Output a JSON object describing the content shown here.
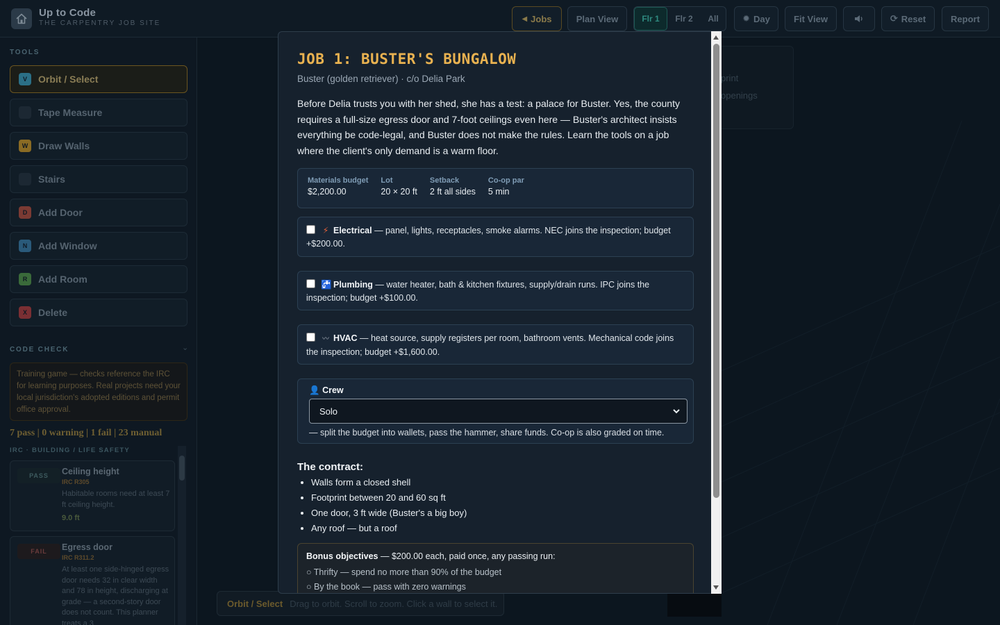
{
  "app": {
    "title": "Up to Code",
    "subtitle": "THE CARPENTRY JOB SITE"
  },
  "toolbar": {
    "jobs": "Jobs",
    "plan_view": "Plan View",
    "floors": [
      "Flr 1",
      "Flr 2",
      "All"
    ],
    "active_floor": "Flr 1",
    "day": "Day",
    "fit_view": "Fit View",
    "sound_icon": "speaker-icon",
    "reset": "Reset",
    "report": "Report"
  },
  "sidebar": {
    "tools_heading": "TOOLS",
    "tools": [
      {
        "key": "V",
        "label": "Orbit / Select",
        "color": "#2b6f86",
        "active": true
      },
      {
        "key": "",
        "label": "Tape Measure",
        "color": "#1c2833",
        "active": false
      },
      {
        "key": "W",
        "label": "Draw Walls",
        "color": "#8a6b24",
        "active": false
      },
      {
        "key": "",
        "label": "Stairs",
        "color": "#1c2833",
        "active": false
      },
      {
        "key": "D",
        "label": "Add Door",
        "color": "#7a3a33",
        "active": false
      },
      {
        "key": "N",
        "label": "Add Window",
        "color": "#2a5a7a",
        "active": false
      },
      {
        "key": "R",
        "label": "Add Room",
        "color": "#3a6a3a",
        "active": false
      },
      {
        "key": "X",
        "label": "Delete",
        "color": "#7a2f33",
        "active": false
      }
    ],
    "code_check_heading": "CODE CHECK",
    "code_check_toggle": "⌄",
    "notice": "Training game — checks reference the IRC for learning purposes. Real projects need your local jurisdiction's adopted editions and permit office approval.",
    "summary": "7 pass | 0 warning | 1 fail | 23 manual",
    "group_heading": "IRC · BUILDING / LIFE SAFETY",
    "checks": [
      {
        "status": "PASS",
        "title": "Ceiling height",
        "code": "IRC R305",
        "desc": "Habitable rooms need at least 7 ft ceiling height.",
        "value": "9.0 ft"
      },
      {
        "status": "FAIL",
        "title": "Egress door",
        "code": "IRC R311.2",
        "desc": "At least one side-hinged egress door needs 32 in clear width and 78 in height, discharging at grade — a second-story door does not count. This planner treats a 3",
        "value": ""
      }
    ]
  },
  "viewport": {
    "bg_card_lines": [
      "print",
      "openings"
    ],
    "status_mode": "Orbit / Select",
    "status_hint": "Drag to orbit. Scroll to zoom. Click a wall to select it."
  },
  "modal": {
    "title": "JOB 1: BUSTER'S BUNGALOW",
    "client": "Buster (golden retriever) · c/o Delia Park",
    "intro": "Before Delia trusts you with her shed, she has a test: a palace for Buster. Yes, the county requires a full-size egress door and 7-foot ceilings even here — Buster's architect insists everything be code-legal, and Buster does not make the rules. Learn the tools on a job where the client's only demand is a warm floor.",
    "stats": [
      {
        "label": "Materials budget",
        "value": "$2,200.00"
      },
      {
        "label": "Lot",
        "value": "20 × 20 ft"
      },
      {
        "label": "Setback",
        "value": "2 ft all sides"
      },
      {
        "label": "Co-op par",
        "value": "5 min"
      }
    ],
    "options": [
      {
        "icon": "⚡",
        "icon_name": "lightning-icon",
        "name": "Electrical",
        "desc": " — panel, lights, receptacles, smoke alarms. NEC joins the inspection; budget +$200.00.",
        "checked": false
      },
      {
        "icon": "🚰",
        "icon_name": "faucet-icon",
        "name": "Plumbing",
        "desc": " — water heater, bath & kitchen fixtures, supply/drain runs. IPC joins the inspection; budget +$100.00.",
        "checked": false
      },
      {
        "icon": "〰",
        "icon_name": "airflow-icon",
        "name": "HVAC",
        "desc": " — heat source, supply registers per room, bathroom vents. Mechanical code joins the inspection; budget +$1,600.00.",
        "checked": false
      }
    ],
    "crew": {
      "label": "Crew",
      "selected": "Solo",
      "note": "— split the budget into wallets, pass the hammer, share funds. Co-op is also graded on time."
    },
    "contract_heading": "The contract:",
    "contract_items": [
      "Walls form a closed shell",
      "Footprint between 20 and 60 sq ft",
      "One door, 3 ft wide (Buster's a big boy)",
      "Any roof — but a roof"
    ],
    "bonus": {
      "heading": "Bonus objectives",
      "heading_rest": " — $200.00 each, paid once, any passing run:",
      "items": [
        "○ Thrifty — spend no more than 90% of the budget",
        "○ By the book — pass with zero warnings"
      ]
    }
  }
}
